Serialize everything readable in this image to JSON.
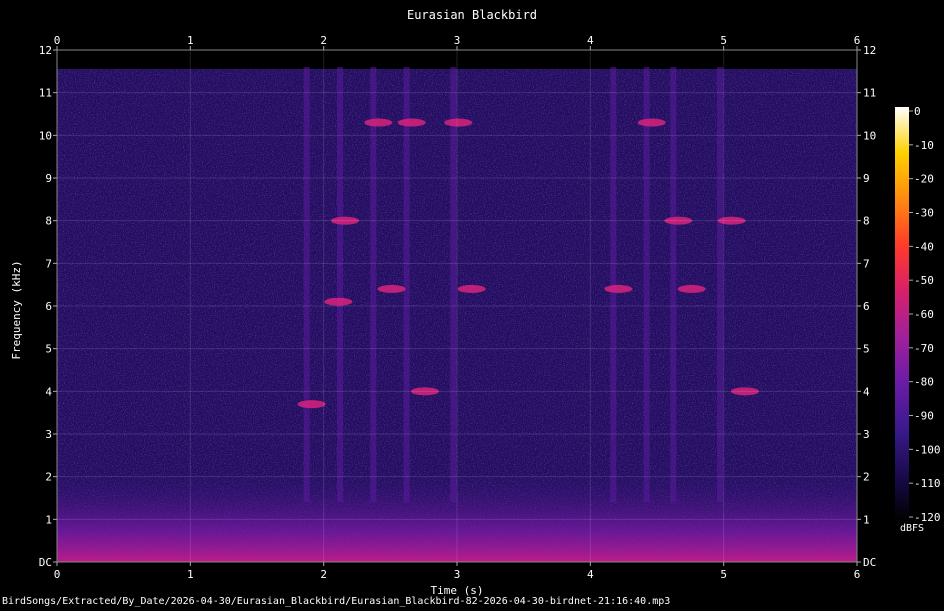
{
  "chart_data": {
    "type": "heatmap",
    "subtype": "spectrogram",
    "title": "Eurasian Blackbird",
    "xlabel": "Time (s)",
    "ylabel": "Frequency (kHz)",
    "xlim": [
      0,
      6
    ],
    "ylim": [
      0,
      12
    ],
    "x_ticks": [
      "0",
      "1",
      "2",
      "3",
      "4",
      "5",
      "6"
    ],
    "y_ticks": [
      "DC",
      "1",
      "2",
      "3",
      "4",
      "5",
      "6",
      "7",
      "8",
      "9",
      "10",
      "11",
      "12"
    ],
    "colorbar": {
      "label": "dBFS",
      "range": [
        -120,
        0
      ],
      "ticks": [
        "0",
        "-10",
        "-20",
        "-30",
        "-40",
        "-50",
        "-60",
        "-70",
        "-80",
        "-90",
        "-100",
        "-110",
        "-120"
      ]
    },
    "grid": true,
    "background_color": "#000000",
    "colormap": [
      "#000000",
      "#1a0b4d",
      "#3a1a8c",
      "#6a1ba8",
      "#a0209c",
      "#d8206a",
      "#ff3b2a",
      "#ff8a10",
      "#ffd000",
      "#ffffff"
    ],
    "series": [
      {
        "x": [
          1.85,
          2.05,
          2.1,
          2.35,
          2.45,
          2.6,
          2.7,
          2.95,
          3.05,
          4.15,
          4.4,
          4.6,
          4.7,
          5.0,
          5.1
        ],
        "y": [
          3.7,
          6.1,
          8.0,
          10.3,
          6.4,
          10.3,
          4.0,
          10.3,
          6.4,
          6.4,
          10.3,
          8.0,
          6.4,
          8.0,
          4.0
        ]
      }
    ]
  },
  "source_file": "BirdSongs/Extracted/By_Date/2026-04-30/Eurasian_Blackbird/Eurasian_Blackbird-82-2026-04-30-birdnet-21:16:40.mp3"
}
